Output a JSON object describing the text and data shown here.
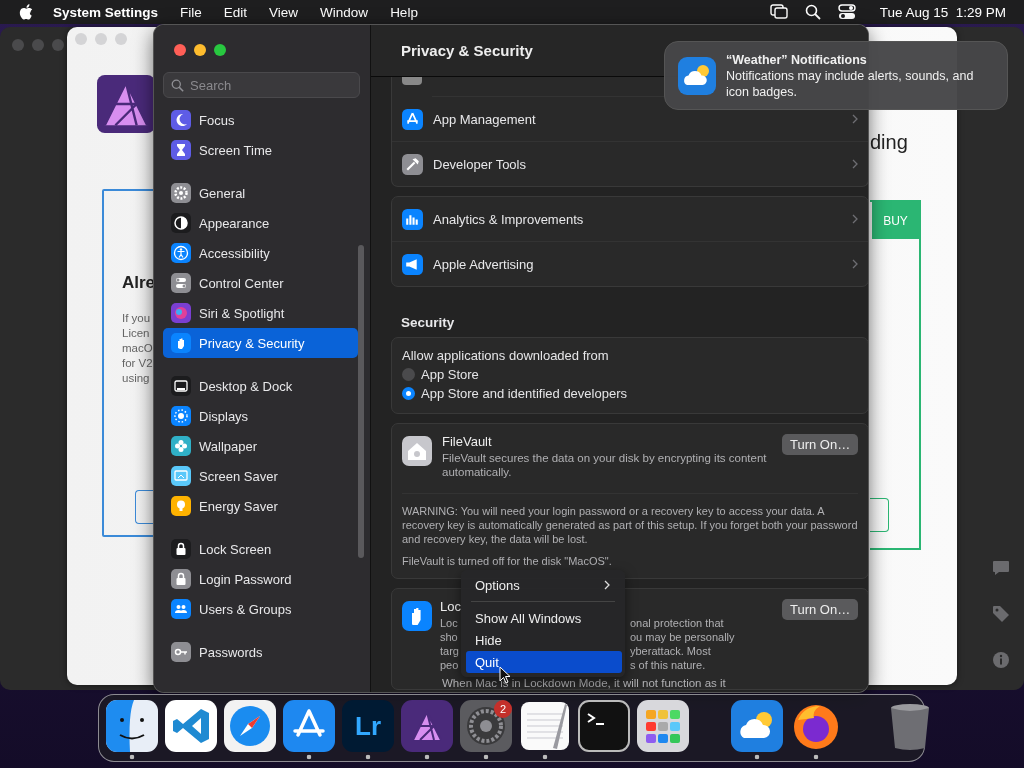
{
  "menu_bar": {
    "app_name": "System Settings",
    "menus": [
      "File",
      "Edit",
      "View",
      "Window",
      "Help"
    ],
    "clock": "Tue Aug 15  1:29 PM"
  },
  "affinity_window": {
    "left_panel": {
      "heading": "Alre",
      "lines": [
        "If you",
        "Licen",
        "macO",
        "for V2",
        "using"
      ]
    },
    "right_panel": {
      "heading": "ding",
      "tab": "BUY"
    }
  },
  "settings_window": {
    "title": "Privacy & Security",
    "search": {
      "placeholder": "Search"
    },
    "sidebar_groups": [
      {
        "items": [
          {
            "label": "Focus",
            "selected": false
          },
          {
            "label": "Screen Time",
            "selected": false
          }
        ]
      },
      {
        "items": [
          {
            "label": "General",
            "selected": false
          },
          {
            "label": "Appearance",
            "selected": false
          },
          {
            "label": "Accessibility",
            "selected": false
          },
          {
            "label": "Control Center",
            "selected": false
          },
          {
            "label": "Siri & Spotlight",
            "selected": false
          },
          {
            "label": "Privacy & Security",
            "selected": true
          }
        ]
      },
      {
        "items": [
          {
            "label": "Desktop & Dock",
            "selected": false
          },
          {
            "label": "Displays",
            "selected": false
          },
          {
            "label": "Wallpaper",
            "selected": false
          },
          {
            "label": "Screen Saver",
            "selected": false
          },
          {
            "label": "Energy Saver",
            "selected": false
          }
        ]
      },
      {
        "items": [
          {
            "label": "Lock Screen",
            "selected": false
          },
          {
            "label": "Login Password",
            "selected": false
          },
          {
            "label": "Users & Groups",
            "selected": false
          }
        ]
      },
      {
        "items": [
          {
            "label": "Passwords",
            "selected": false
          }
        ]
      }
    ],
    "privacy_groups": [
      {
        "rows": [
          {
            "label": "App Management"
          },
          {
            "label": "Developer Tools"
          }
        ]
      },
      {
        "rows": [
          {
            "label": "Analytics & Improvements"
          },
          {
            "label": "Apple Advertising"
          }
        ]
      }
    ],
    "security": {
      "heading": "Security",
      "allow": {
        "label": "Allow applications downloaded from",
        "options": [
          {
            "label": "App Store",
            "selected": false
          },
          {
            "label": "App Store and identified developers",
            "selected": true
          }
        ]
      },
      "filevault": {
        "title": "FileVault",
        "description": "FileVault secures the data on your disk by encrypting its content automatically.",
        "button": "Turn On…",
        "warning": "WARNING: You will need your login password or a recovery key to access your data. A recovery key is automatically generated as part of this setup. If you forget both your password and recovery key, the data will be lost.",
        "status": "FileVault is turned off for the disk \"MacOS\"."
      },
      "lockdown": {
        "title": "Loc",
        "button": "Turn On…",
        "lines": [
          {
            "left": "Loc",
            "right": "onal protection that"
          },
          {
            "left": "sho",
            "right": "ou may be personally"
          },
          {
            "left": "targ",
            "right": "yberattack. Most"
          },
          {
            "left": "peo",
            "right": "s of this nature."
          }
        ],
        "note": "When Mac is in Lockdown Mode, it will not function as it"
      }
    }
  },
  "notification": {
    "title": "“Weather” Notifications",
    "body": "Notifications may include alerts, sounds, and icon badges."
  },
  "context_menu": {
    "items": [
      {
        "kind": "submenu",
        "label": "Options",
        "selected": false
      },
      {
        "kind": "separator"
      },
      {
        "kind": "item",
        "label": "Show All Windows",
        "selected": false
      },
      {
        "kind": "item",
        "label": "Hide",
        "selected": false
      },
      {
        "kind": "item",
        "label": "Quit",
        "selected": true
      }
    ]
  },
  "dock": {
    "items": [
      {
        "kind": "finder",
        "running": true
      },
      {
        "kind": "code",
        "running": false
      },
      {
        "kind": "safari",
        "running": false
      },
      {
        "kind": "appstore",
        "running": true
      },
      {
        "kind": "lightroom",
        "label": "Lr",
        "running": true
      },
      {
        "kind": "affinity",
        "running": true
      },
      {
        "kind": "settings",
        "badge": "2",
        "running": true
      },
      {
        "kind": "textedit",
        "running": true
      },
      {
        "kind": "terminal",
        "running": false
      },
      {
        "kind": "launchpad",
        "running": false
      },
      {
        "kind": "divider"
      },
      {
        "kind": "weather",
        "running": true
      },
      {
        "kind": "firefox",
        "running": true
      },
      {
        "kind": "divider"
      },
      {
        "kind": "trash",
        "running": false
      }
    ]
  }
}
